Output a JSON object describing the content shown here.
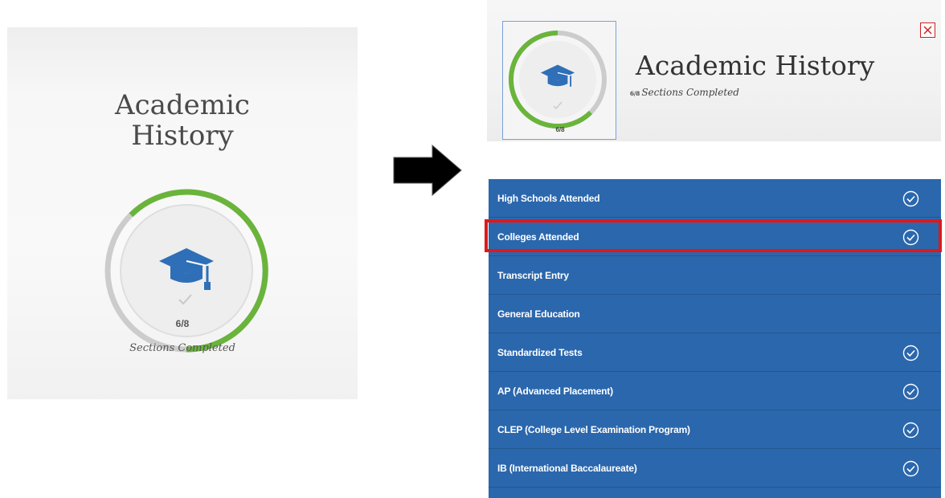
{
  "left_card": {
    "title_line1": "Academic",
    "title_line2": "History",
    "count": "6/8",
    "caption": "Sections Completed",
    "progress": 0.75,
    "icon": "graduation-cap-icon"
  },
  "panel": {
    "title": "Academic History",
    "subtitle_count": "6/8",
    "subtitle": "Sections Completed",
    "thumb_count": "6/8",
    "close_icon": "close-icon",
    "items": [
      {
        "label": "High Schools Attended",
        "completed": true
      },
      {
        "label": "Colleges Attended",
        "completed": true
      },
      {
        "label": "Transcript Entry",
        "completed": false
      },
      {
        "label": "General Education",
        "completed": false
      },
      {
        "label": "Standardized Tests",
        "completed": true
      },
      {
        "label": "AP (Advanced Placement)",
        "completed": true
      },
      {
        "label": "CLEP (College Level Examination Program)",
        "completed": true
      },
      {
        "label": "IB (International Baccalaureate)",
        "completed": true
      }
    ]
  },
  "colors": {
    "list_bg": "#2b67ad",
    "progress_green": "#6ab43c",
    "cap_blue": "#2e6fb8",
    "highlight_red": "#e01818"
  }
}
